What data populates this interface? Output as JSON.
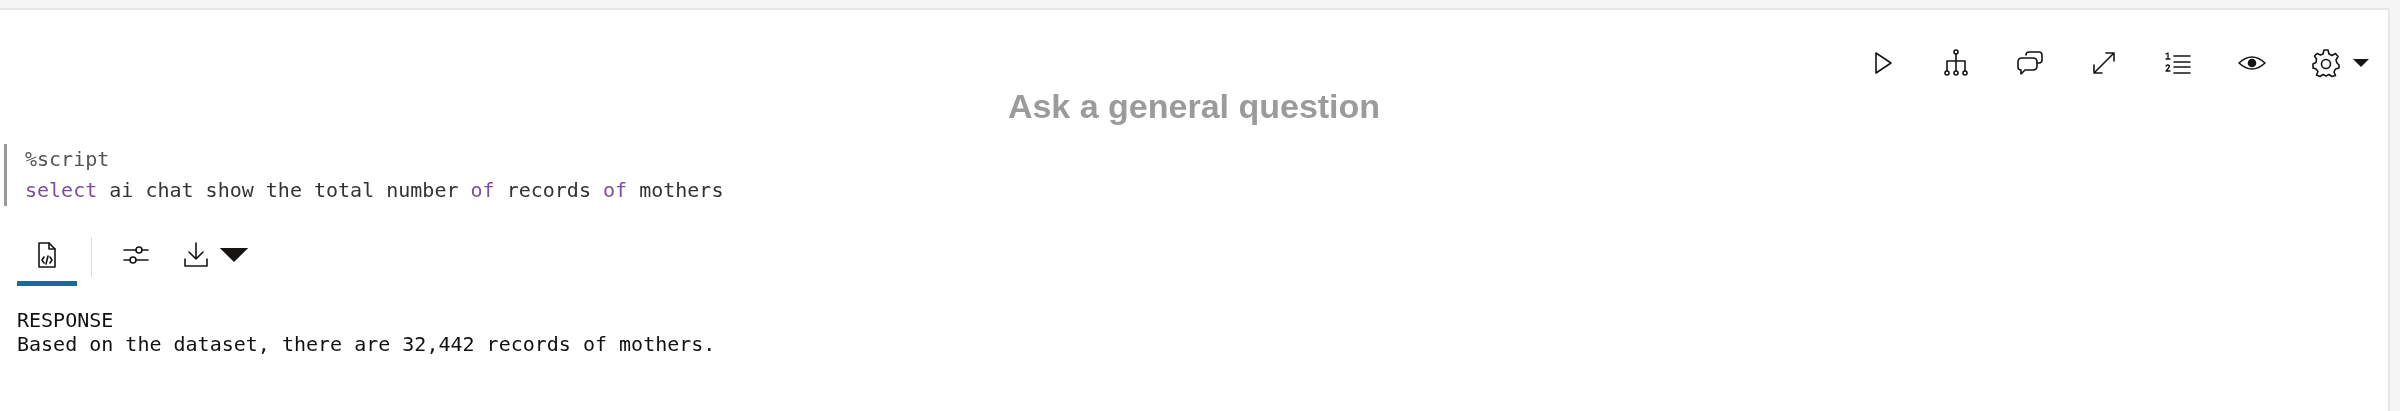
{
  "toolbar": {
    "buttons": [
      {
        "kind": "run"
      },
      {
        "kind": "tree"
      },
      {
        "kind": "chat"
      },
      {
        "kind": "expand"
      },
      {
        "kind": "list"
      },
      {
        "kind": "eye"
      },
      {
        "kind": "gear"
      }
    ]
  },
  "title": "Ask a general question",
  "code": {
    "lines": [
      [
        {
          "kind": "directive",
          "text": "%script"
        }
      ],
      [
        {
          "kind": "keyword",
          "text": "select"
        },
        {
          "kind": "text",
          "text": " ai chat show the total number "
        },
        {
          "kind": "keyword",
          "text": "of"
        },
        {
          "kind": "text",
          "text": " records "
        },
        {
          "kind": "keyword",
          "text": "of"
        },
        {
          "kind": "text",
          "text": " mothers"
        }
      ]
    ]
  },
  "output_tabs": [
    {
      "kind": "code",
      "selected": true
    },
    {
      "kind": "settings",
      "selected": false
    },
    {
      "kind": "download",
      "selected": false
    }
  ],
  "output": {
    "heading": "RESPONSE",
    "text": "Based on the dataset, there are 32,442 records of mothers."
  }
}
